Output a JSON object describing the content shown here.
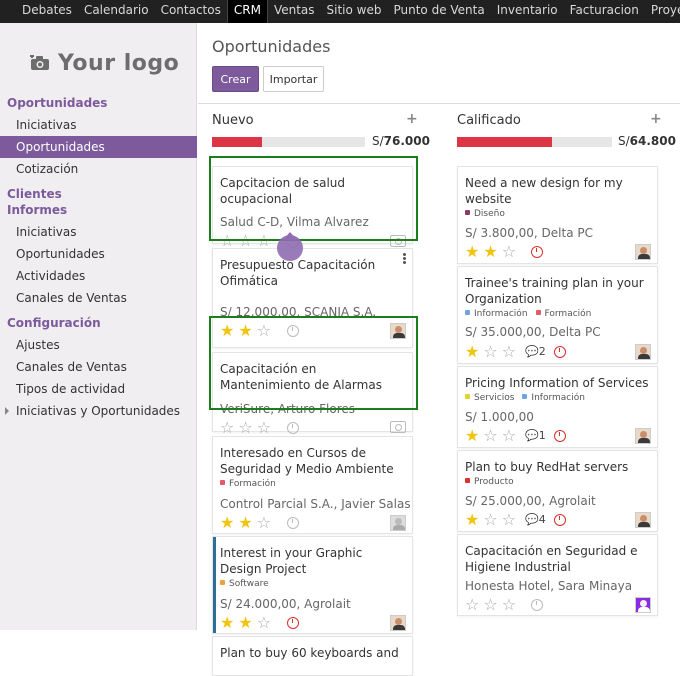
{
  "topnav": [
    "Debates",
    "Calendario",
    "Contactos",
    "CRM",
    "Ventas",
    "Sitio web",
    "Punto de Venta",
    "Inventario",
    "Facturacion",
    "Proyecto"
  ],
  "topnav_active": "CRM",
  "logo_text": "Your logo",
  "sidebar": {
    "sections": [
      {
        "title": "Oportunidades",
        "items": [
          "Iniciativas",
          "Oportunidades",
          "Cotización"
        ]
      },
      {
        "title": "Clientes",
        "items": []
      },
      {
        "title": "Informes",
        "items": [
          "Iniciativas",
          "Oportunidades",
          "Actividades",
          "Canales de Ventas"
        ]
      },
      {
        "title": "Configuración",
        "items": [
          "Ajustes",
          "Canales de Ventas",
          "Tipos de actividad",
          "Iniciativas y Oportunidades"
        ]
      }
    ],
    "active_item": "Oportunidades"
  },
  "main": {
    "title": "Oportunidades",
    "create_label": "Crear",
    "import_label": "Importar"
  },
  "columns": [
    {
      "name": "Nuevo",
      "total_prefix": "S/",
      "total": "76.000",
      "progress": 0.33,
      "cards": [
        {
          "title": "Capcitacion de salud ocupacional",
          "sub": "Salud C-D, Vilma Alvarez",
          "stars": 0
        },
        {
          "title": "Presupuesto Capacitación Ofimática",
          "sub": "S/ 12.000,00, SCANIA S.A.",
          "stars": 2
        },
        {
          "title": "Capacitación en Mantenimiento de Alarmas",
          "sub": "VeriSure, Arturo Flores",
          "stars": 0
        },
        {
          "title": "Interesado en Cursos de Seguridad y Medio Ambiente",
          "tag": "Formación",
          "sub": "Control Parcial S.A., Javier Salas",
          "stars": 2
        },
        {
          "title": "Interest in your Graphic Design Project",
          "tag": "Software",
          "sub": "S/ 24.000,00, Agrolait",
          "stars": 2
        },
        {
          "title": "Plan to buy 60 keyboards and",
          "sub": "",
          "stars": 0
        }
      ]
    },
    {
      "name": "Calificado",
      "total_prefix": "S/",
      "total": "64.800",
      "progress": 0.61,
      "cards": [
        {
          "title": "Need a new design for my website",
          "tags": [
            "Diseño"
          ],
          "sub": "S/ 3.800,00, Delta PC",
          "stars": 2
        },
        {
          "title": "Trainee's training plan in your Organization",
          "tags": [
            "Información",
            "Formación"
          ],
          "sub": "S/ 35.000,00, Delta PC",
          "stars": 1,
          "messages": "2"
        },
        {
          "title": "Pricing Information of Services",
          "tags": [
            "Servicios",
            "Información"
          ],
          "sub": "S/ 1.000,00",
          "stars": 1,
          "messages": "1"
        },
        {
          "title": "Plan to buy RedHat servers",
          "tags": [
            "Producto"
          ],
          "sub": "S/ 25.000,00, Agrolait",
          "stars": 1,
          "messages": "4"
        },
        {
          "title": "Capacitación en Seguridad e Higiene Industrial",
          "sub": "Honesta Hotel, Sara Minaya",
          "stars": 0
        }
      ]
    }
  ],
  "colors": {
    "brand": "#7c5a9c",
    "highlight": "#1c7d1c",
    "danger": "#dc3545",
    "star": "#f0c40f"
  }
}
